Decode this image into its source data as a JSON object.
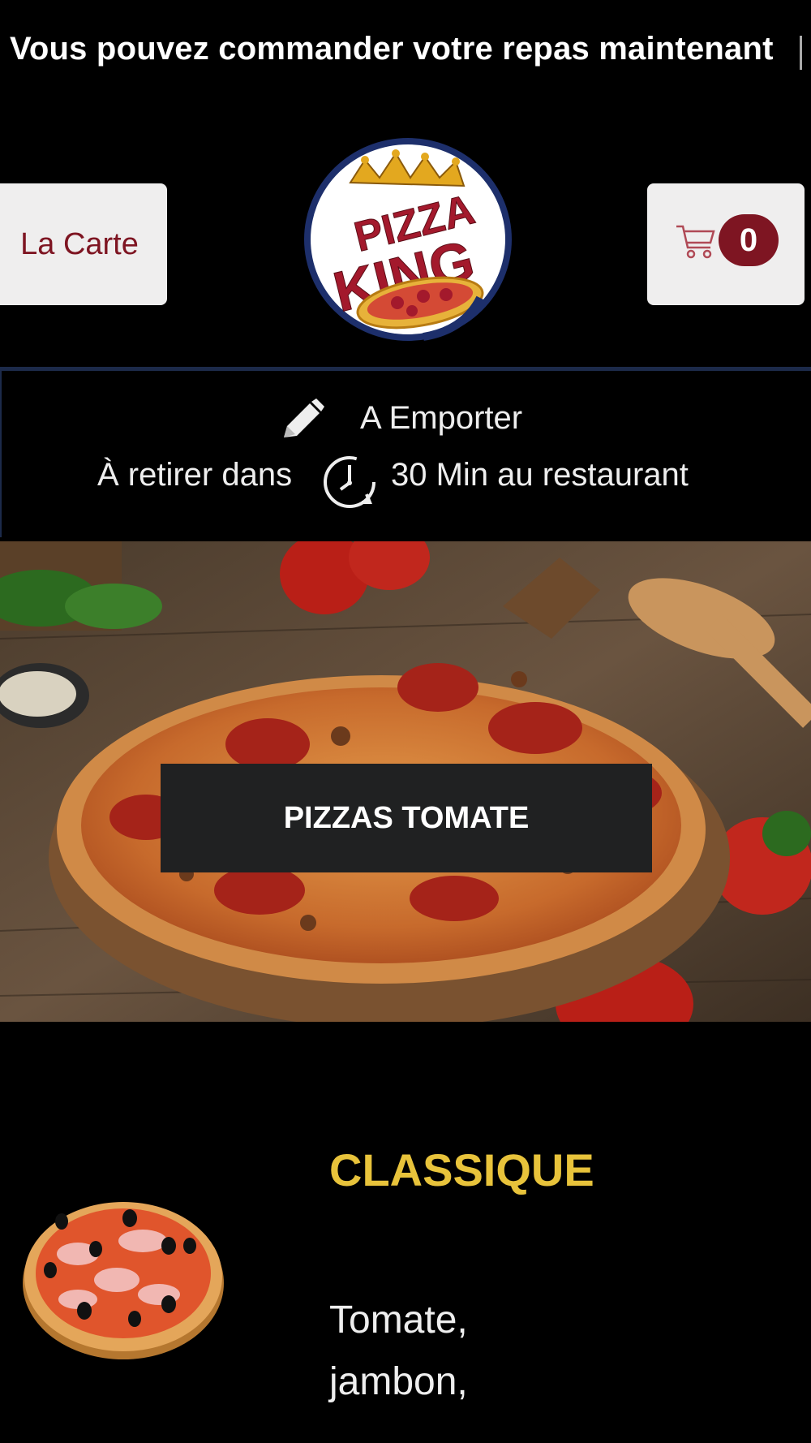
{
  "announcement": {
    "text": "Vous pouvez commander votre repas maintenant"
  },
  "header": {
    "menu_button": "La Carte",
    "cart_count": "0",
    "logo": {
      "line1": "PIZZA",
      "line2": "KING"
    }
  },
  "order": {
    "mode": "A Emporter",
    "pickup_prefix": "À retirer dans",
    "pickup_suffix": "30 Min au restaurant"
  },
  "hero": {
    "category_button": "PIZZAS TOMATE"
  },
  "product": {
    "name": "CLASSIQUE",
    "description_line1": "Tomate,",
    "description_line2": "jambon,"
  },
  "colors": {
    "brand_red": "#7e1522",
    "accent_yellow": "#e8c33b",
    "background": "#000000",
    "button_light": "#efeeee"
  }
}
